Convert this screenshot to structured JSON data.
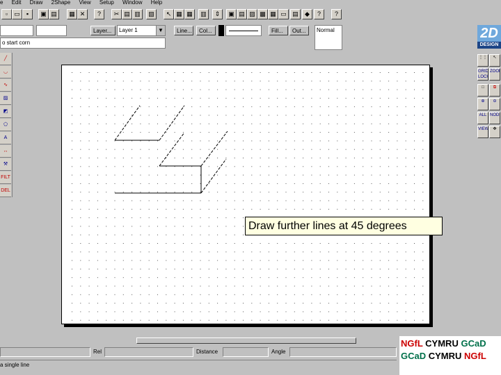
{
  "menu": [
    "e",
    "Edit",
    "Draw",
    "2Shape",
    "View",
    "Setup",
    "Window",
    "Help"
  ],
  "property_bar": {
    "layer_button": "Layer...",
    "layer_select": "Layer 1",
    "line_button": "Line...",
    "col_button": "Col...",
    "fill_button": "Fill...",
    "out_button": "Out...",
    "style_preview": "Normal",
    "command_input": "o start corn"
  },
  "logo": {
    "top": "2D",
    "bottom": "DESIGN"
  },
  "left_tools": [
    "line",
    "arc",
    "curve",
    "hatch",
    "fill",
    "text",
    "dims",
    "tool",
    "3D",
    "FILT",
    "DEL"
  ],
  "right_tools": [
    "grid",
    "SNAP",
    "GRID LOCK",
    "ZOOM",
    "box",
    "zoom-in",
    "zoom-out",
    "ALL",
    "NODE",
    "VIEW"
  ],
  "canvas": {
    "tooltip": "Draw further lines at 45 degrees"
  },
  "coord_bar": {
    "rel_label": "Rel",
    "distance_label": "Distance",
    "angle_label": "Angle"
  },
  "status": "a single line",
  "ngfl": {
    "line1": [
      "NGfL",
      "CYMRU",
      "GCaD"
    ],
    "line2": [
      "GCaD",
      "CYMRU",
      "NGfL"
    ]
  },
  "colors": {
    "accent_red": "#cc0000",
    "accent_green": "#00704a",
    "tooltip_bg": "#ffffe1"
  }
}
